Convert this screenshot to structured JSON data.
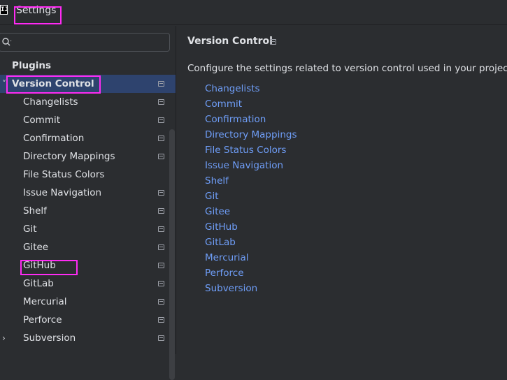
{
  "window": {
    "title": "Settings",
    "app_icon": "intellij-app-icon"
  },
  "search": {
    "placeholder": "",
    "value": ""
  },
  "sidebar": {
    "items": [
      {
        "label": "Plugins",
        "bold": true,
        "selected": false,
        "chevron": "",
        "pin": false
      },
      {
        "label": "Version Control",
        "bold": true,
        "selected": true,
        "chevron": "˅",
        "pin": true
      },
      {
        "label": "Changelists",
        "bold": false,
        "selected": false,
        "chevron": "",
        "pin": true
      },
      {
        "label": "Commit",
        "bold": false,
        "selected": false,
        "chevron": "",
        "pin": true
      },
      {
        "label": "Confirmation",
        "bold": false,
        "selected": false,
        "chevron": "",
        "pin": true
      },
      {
        "label": "Directory Mappings",
        "bold": false,
        "selected": false,
        "chevron": "",
        "pin": true
      },
      {
        "label": "File Status Colors",
        "bold": false,
        "selected": false,
        "chevron": "",
        "pin": false
      },
      {
        "label": "Issue Navigation",
        "bold": false,
        "selected": false,
        "chevron": "",
        "pin": true
      },
      {
        "label": "Shelf",
        "bold": false,
        "selected": false,
        "chevron": "",
        "pin": true
      },
      {
        "label": "Git",
        "bold": false,
        "selected": false,
        "chevron": "",
        "pin": true
      },
      {
        "label": "Gitee",
        "bold": false,
        "selected": false,
        "chevron": "",
        "pin": true
      },
      {
        "label": "GitHub",
        "bold": false,
        "selected": false,
        "chevron": "",
        "pin": true
      },
      {
        "label": "GitLab",
        "bold": false,
        "selected": false,
        "chevron": "",
        "pin": true
      },
      {
        "label": "Mercurial",
        "bold": false,
        "selected": false,
        "chevron": "",
        "pin": true
      },
      {
        "label": "Perforce",
        "bold": false,
        "selected": false,
        "chevron": "",
        "pin": true
      },
      {
        "label": "Subversion",
        "bold": false,
        "selected": false,
        "chevron": "›",
        "pin": true
      }
    ]
  },
  "main": {
    "title": "Version Control",
    "description": "Configure the settings related to version control used in your project",
    "links": [
      "Changelists",
      "Commit",
      "Confirmation",
      "Directory Mappings",
      "File Status Colors",
      "Issue Navigation",
      "Shelf",
      "Git",
      "Gitee",
      "GitHub",
      "GitLab",
      "Mercurial",
      "Perforce",
      "Subversion"
    ]
  },
  "colors": {
    "background": "#2b2d30",
    "selection": "#2e436e",
    "link": "#6f9ef8",
    "highlight_annotation": "#ff2bf4"
  }
}
